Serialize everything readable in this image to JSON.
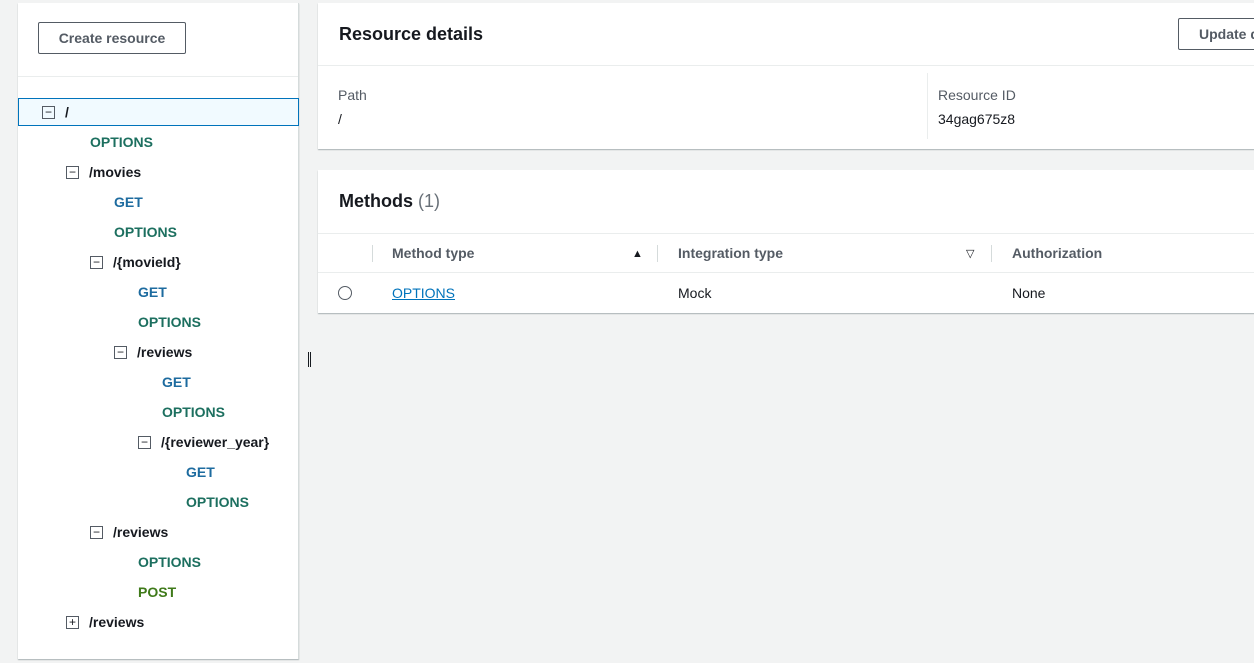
{
  "tree": {
    "create_button": "Create resource",
    "nodes": [
      {
        "kind": "resource",
        "label": "/",
        "expanded": true,
        "selected": true
      },
      {
        "kind": "method",
        "label": "OPTIONS",
        "color": "#1c6f5f"
      },
      {
        "kind": "resource",
        "label": "/movies",
        "expanded": true
      },
      {
        "kind": "method",
        "label": "GET",
        "color": "#1d6b9f"
      },
      {
        "kind": "method",
        "label": "OPTIONS",
        "color": "#1c6f5f"
      },
      {
        "kind": "resource",
        "label": "/{movieId}",
        "expanded": true
      },
      {
        "kind": "method",
        "label": "GET",
        "color": "#1d6b9f"
      },
      {
        "kind": "method",
        "label": "OPTIONS",
        "color": "#1c6f5f"
      },
      {
        "kind": "resource",
        "label": "/reviews",
        "expanded": true
      },
      {
        "kind": "method",
        "label": "GET",
        "color": "#1d6b9f"
      },
      {
        "kind": "method",
        "label": "OPTIONS",
        "color": "#1c6f5f"
      },
      {
        "kind": "resource",
        "label": "/{reviewer_year}",
        "expanded": true
      },
      {
        "kind": "method",
        "label": "GET",
        "color": "#1d6b9f"
      },
      {
        "kind": "method",
        "label": "OPTIONS",
        "color": "#1c6f5f"
      },
      {
        "kind": "resource",
        "label": "/reviews",
        "expanded": true
      },
      {
        "kind": "method",
        "label": "OPTIONS",
        "color": "#1c6f5f"
      },
      {
        "kind": "method",
        "label": "POST",
        "color": "#3f7a1a"
      },
      {
        "kind": "resource",
        "label": "/reviews",
        "expanded": false
      }
    ],
    "collapse_glyph": "−",
    "expand_glyph": "+"
  },
  "details": {
    "title": "Resource details",
    "update_button": "Update d",
    "path_label": "Path",
    "path_value": "/",
    "id_label": "Resource ID",
    "id_value": "34gag675z8"
  },
  "methods": {
    "title": "Methods",
    "count": "(1)",
    "columns": [
      "Method type",
      "Integration type",
      "Authorization"
    ],
    "rows": [
      {
        "method": "OPTIONS",
        "integration": "Mock",
        "authorization": "None"
      }
    ]
  },
  "icons": {
    "sort_asc": "▲",
    "sort_none": "▽"
  },
  "colors": {
    "link": "#0073bb",
    "selected_border": "#0073bb"
  }
}
